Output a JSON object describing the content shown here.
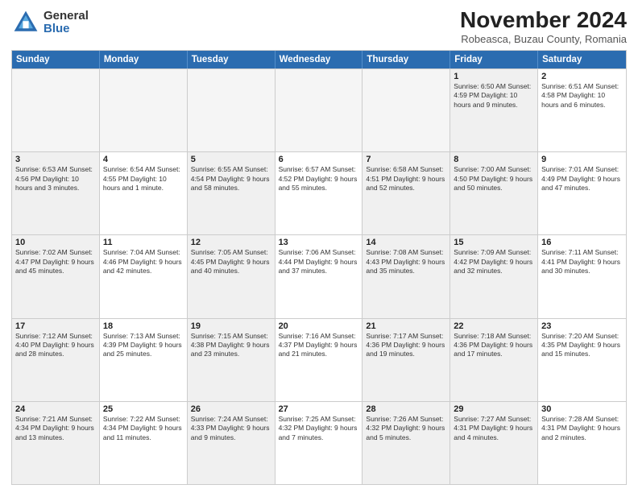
{
  "header": {
    "logo_general": "General",
    "logo_blue": "Blue",
    "title": "November 2024",
    "subtitle": "Robeasca, Buzau County, Romania"
  },
  "calendar": {
    "weekdays": [
      "Sunday",
      "Monday",
      "Tuesday",
      "Wednesday",
      "Thursday",
      "Friday",
      "Saturday"
    ],
    "rows": [
      [
        {
          "day": "",
          "info": "",
          "empty": true
        },
        {
          "day": "",
          "info": "",
          "empty": true
        },
        {
          "day": "",
          "info": "",
          "empty": true
        },
        {
          "day": "",
          "info": "",
          "empty": true
        },
        {
          "day": "",
          "info": "",
          "empty": true
        },
        {
          "day": "1",
          "info": "Sunrise: 6:50 AM\nSunset: 4:59 PM\nDaylight: 10 hours and 9 minutes.",
          "shaded": true
        },
        {
          "day": "2",
          "info": "Sunrise: 6:51 AM\nSunset: 4:58 PM\nDaylight: 10 hours and 6 minutes.",
          "shaded": false
        }
      ],
      [
        {
          "day": "3",
          "info": "Sunrise: 6:53 AM\nSunset: 4:56 PM\nDaylight: 10 hours and 3 minutes.",
          "shaded": true
        },
        {
          "day": "4",
          "info": "Sunrise: 6:54 AM\nSunset: 4:55 PM\nDaylight: 10 hours and 1 minute.",
          "shaded": false
        },
        {
          "day": "5",
          "info": "Sunrise: 6:55 AM\nSunset: 4:54 PM\nDaylight: 9 hours and 58 minutes.",
          "shaded": true
        },
        {
          "day": "6",
          "info": "Sunrise: 6:57 AM\nSunset: 4:52 PM\nDaylight: 9 hours and 55 minutes.",
          "shaded": false
        },
        {
          "day": "7",
          "info": "Sunrise: 6:58 AM\nSunset: 4:51 PM\nDaylight: 9 hours and 52 minutes.",
          "shaded": true
        },
        {
          "day": "8",
          "info": "Sunrise: 7:00 AM\nSunset: 4:50 PM\nDaylight: 9 hours and 50 minutes.",
          "shaded": true
        },
        {
          "day": "9",
          "info": "Sunrise: 7:01 AM\nSunset: 4:49 PM\nDaylight: 9 hours and 47 minutes.",
          "shaded": false
        }
      ],
      [
        {
          "day": "10",
          "info": "Sunrise: 7:02 AM\nSunset: 4:47 PM\nDaylight: 9 hours and 45 minutes.",
          "shaded": true
        },
        {
          "day": "11",
          "info": "Sunrise: 7:04 AM\nSunset: 4:46 PM\nDaylight: 9 hours and 42 minutes.",
          "shaded": false
        },
        {
          "day": "12",
          "info": "Sunrise: 7:05 AM\nSunset: 4:45 PM\nDaylight: 9 hours and 40 minutes.",
          "shaded": true
        },
        {
          "day": "13",
          "info": "Sunrise: 7:06 AM\nSunset: 4:44 PM\nDaylight: 9 hours and 37 minutes.",
          "shaded": false
        },
        {
          "day": "14",
          "info": "Sunrise: 7:08 AM\nSunset: 4:43 PM\nDaylight: 9 hours and 35 minutes.",
          "shaded": true
        },
        {
          "day": "15",
          "info": "Sunrise: 7:09 AM\nSunset: 4:42 PM\nDaylight: 9 hours and 32 minutes.",
          "shaded": true
        },
        {
          "day": "16",
          "info": "Sunrise: 7:11 AM\nSunset: 4:41 PM\nDaylight: 9 hours and 30 minutes.",
          "shaded": false
        }
      ],
      [
        {
          "day": "17",
          "info": "Sunrise: 7:12 AM\nSunset: 4:40 PM\nDaylight: 9 hours and 28 minutes.",
          "shaded": true
        },
        {
          "day": "18",
          "info": "Sunrise: 7:13 AM\nSunset: 4:39 PM\nDaylight: 9 hours and 25 minutes.",
          "shaded": false
        },
        {
          "day": "19",
          "info": "Sunrise: 7:15 AM\nSunset: 4:38 PM\nDaylight: 9 hours and 23 minutes.",
          "shaded": true
        },
        {
          "day": "20",
          "info": "Sunrise: 7:16 AM\nSunset: 4:37 PM\nDaylight: 9 hours and 21 minutes.",
          "shaded": false
        },
        {
          "day": "21",
          "info": "Sunrise: 7:17 AM\nSunset: 4:36 PM\nDaylight: 9 hours and 19 minutes.",
          "shaded": true
        },
        {
          "day": "22",
          "info": "Sunrise: 7:18 AM\nSunset: 4:36 PM\nDaylight: 9 hours and 17 minutes.",
          "shaded": true
        },
        {
          "day": "23",
          "info": "Sunrise: 7:20 AM\nSunset: 4:35 PM\nDaylight: 9 hours and 15 minutes.",
          "shaded": false
        }
      ],
      [
        {
          "day": "24",
          "info": "Sunrise: 7:21 AM\nSunset: 4:34 PM\nDaylight: 9 hours and 13 minutes.",
          "shaded": true
        },
        {
          "day": "25",
          "info": "Sunrise: 7:22 AM\nSunset: 4:34 PM\nDaylight: 9 hours and 11 minutes.",
          "shaded": false
        },
        {
          "day": "26",
          "info": "Sunrise: 7:24 AM\nSunset: 4:33 PM\nDaylight: 9 hours and 9 minutes.",
          "shaded": true
        },
        {
          "day": "27",
          "info": "Sunrise: 7:25 AM\nSunset: 4:32 PM\nDaylight: 9 hours and 7 minutes.",
          "shaded": false
        },
        {
          "day": "28",
          "info": "Sunrise: 7:26 AM\nSunset: 4:32 PM\nDaylight: 9 hours and 5 minutes.",
          "shaded": true
        },
        {
          "day": "29",
          "info": "Sunrise: 7:27 AM\nSunset: 4:31 PM\nDaylight: 9 hours and 4 minutes.",
          "shaded": true
        },
        {
          "day": "30",
          "info": "Sunrise: 7:28 AM\nSunset: 4:31 PM\nDaylight: 9 hours and 2 minutes.",
          "shaded": false
        }
      ]
    ]
  }
}
